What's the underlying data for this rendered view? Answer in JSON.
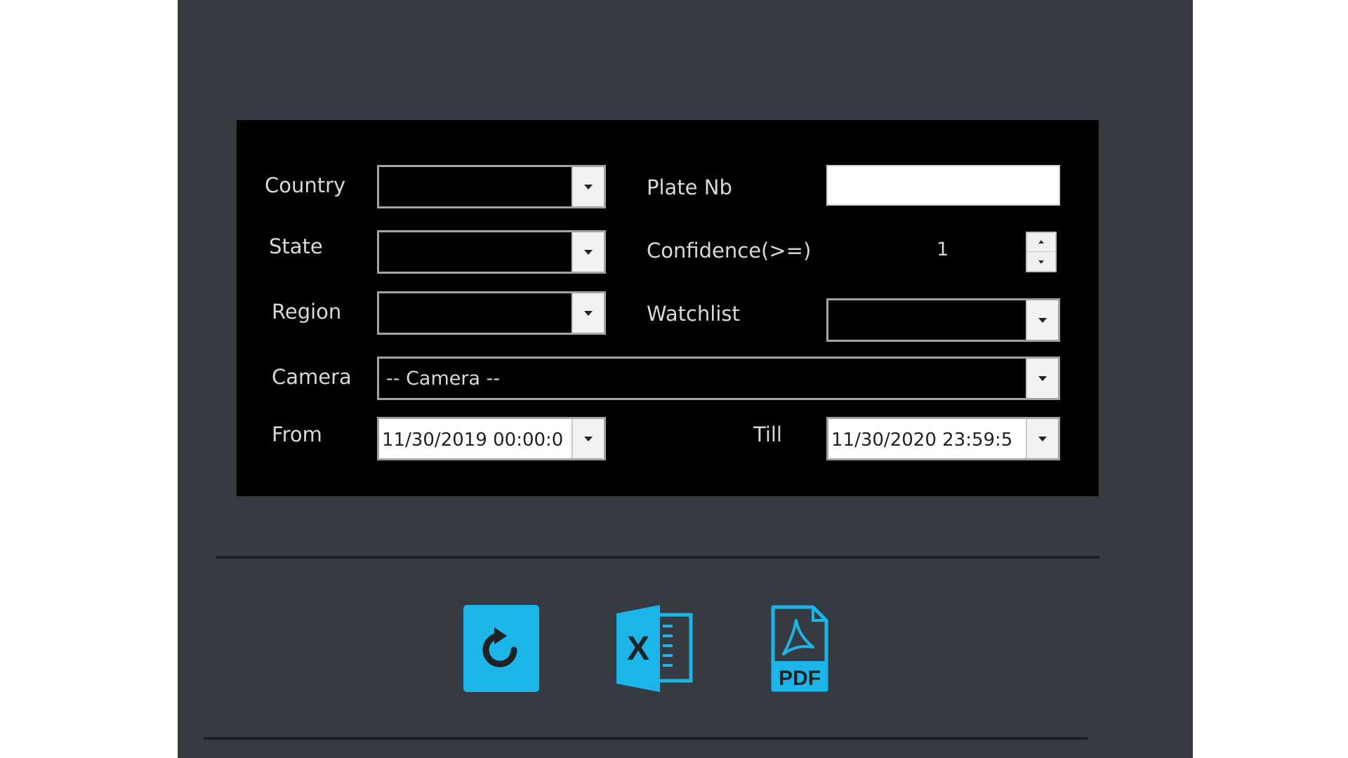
{
  "form": {
    "country_label": "Country",
    "state_label": "State",
    "region_label": "Region",
    "camera_label": "Camera",
    "from_label": "From",
    "till_label": "Till",
    "plate_label": "Plate Nb",
    "confidence_label": "Confidence(>=)",
    "watchlist_label": "Watchlist",
    "country_value": "",
    "state_value": "",
    "region_value": "",
    "watchlist_value": "",
    "plate_value": "",
    "camera_value": "-- Camera --",
    "confidence_value": "1",
    "from_value": "11/30/2019 00:00:0",
    "till_value": "11/30/2020 23:59:5"
  },
  "actions": {
    "excel_letter": "X",
    "pdf_text": "PDF"
  },
  "colors": {
    "panel_bg": "#363a43",
    "form_bg": "#000000",
    "accent": "#1cb5e8",
    "label_text": "#d8d8d8"
  },
  "icons": {
    "refresh": "refresh-icon",
    "excel": "excel-export-icon",
    "pdf": "pdf-export-icon"
  }
}
